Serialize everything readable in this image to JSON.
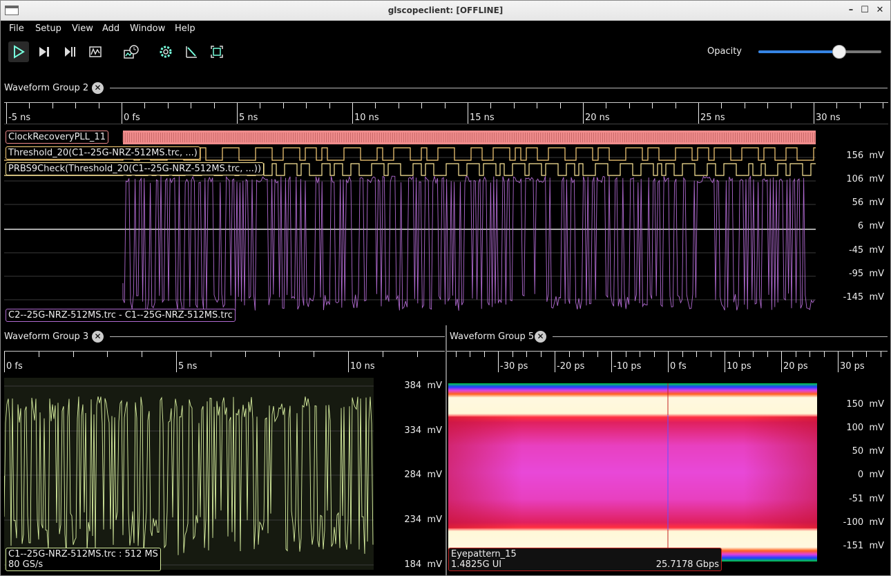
{
  "window": {
    "title": "glscopeclient: [OFFLINE]"
  },
  "menu": {
    "items": [
      "File",
      "Setup",
      "View",
      "Add",
      "Window",
      "Help"
    ]
  },
  "toolbar": {
    "opacity_label": "Opacity",
    "opacity_value": 0.66
  },
  "group2": {
    "title": "Waveform Group 2",
    "time_labels": [
      "-5 ns",
      "0 fs",
      "5 ns",
      "10 ns",
      "15 ns",
      "20 ns",
      "25 ns",
      "30 ns"
    ],
    "y_labels": [
      "156  mV",
      "106  mV",
      "56  mV",
      "6  mV",
      "-45  mV",
      "-95  mV",
      "-145  mV"
    ],
    "channels": {
      "clock": "ClockRecoveryPLL_11",
      "threshold": "Threshold_20(C1--25G-NRZ-512MS.trc, ...)",
      "prbs": "PRBS9Check(Threshold_20(C1--25G-NRZ-512MS.trc, ...))",
      "analog": "C2--25G-NRZ-512MS.trc - C1--25G-NRZ-512MS.trc"
    },
    "colors": {
      "clock": "#f08c8c",
      "threshold": "#ffd27a",
      "prbs": "#ffe99a",
      "analog": "#b06ad0"
    }
  },
  "group3": {
    "title": "Waveform Group 3",
    "time_labels": [
      "0 fs",
      "5 ns",
      "10 ns"
    ],
    "y_labels": [
      "384  mV",
      "334  mV",
      "284  mV",
      "234  mV",
      "184  mV"
    ],
    "channel": {
      "name": "C1--25G-NRZ-512MS.trc : 512 MS",
      "rate": "80 GS/s"
    },
    "colors": {
      "trace": "#d9f0a0"
    }
  },
  "group5": {
    "title": "Waveform Group 5",
    "time_labels": [
      "-30 ps",
      "-20 ps",
      "-10 ps",
      "0 fs",
      "10 ps",
      "20 ps",
      "30 ps"
    ],
    "y_labels": [
      "150  mV",
      "100  mV",
      "50  mV",
      "0  mV",
      "-51  mV",
      "-100  mV",
      "-151  mV"
    ],
    "channel": {
      "name": "Eyepattern_15",
      "ui": "1.4825G UI",
      "rate": "25.7178 Gbps"
    }
  }
}
